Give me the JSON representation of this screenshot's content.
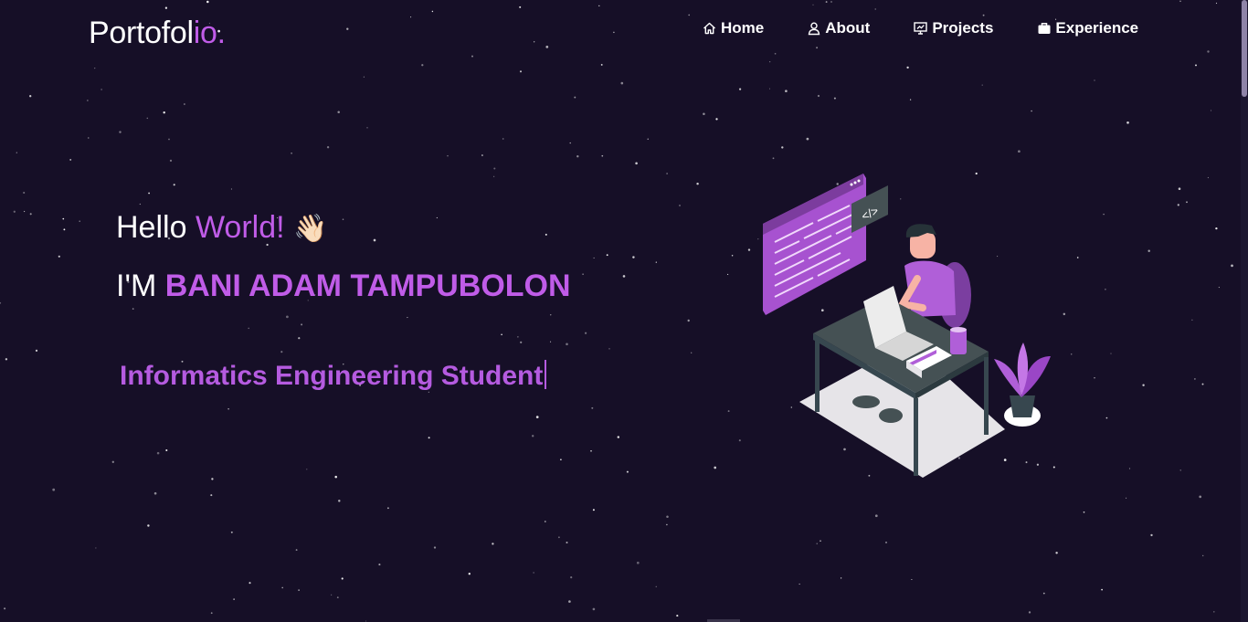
{
  "header": {
    "brand_main": "Portofol",
    "brand_accent": "io."
  },
  "nav": {
    "items": [
      {
        "label": "Home",
        "icon": "home-icon"
      },
      {
        "label": "About",
        "icon": "user-icon"
      },
      {
        "label": "Projects",
        "icon": "presentation-icon"
      },
      {
        "label": "Experience",
        "icon": "briefcase-icon"
      }
    ]
  },
  "hero": {
    "greeting": "Hello",
    "greeting_accent": "World!",
    "wave_emoji": "👋🏻",
    "intro": "I'M",
    "name": "BANI ADAM TAMPUBOLON",
    "role": "Informatics Engineering Student",
    "illustration_code_tag": "</>"
  },
  "colors": {
    "background": "#160f27",
    "accent": "#c05ce8",
    "text": "#ffffff"
  }
}
